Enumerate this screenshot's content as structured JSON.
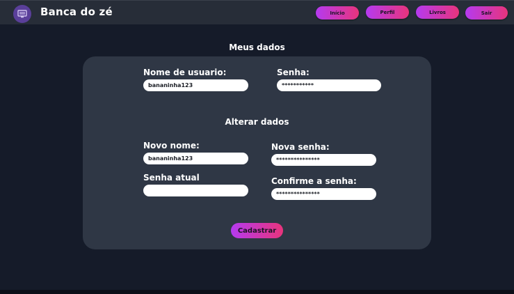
{
  "header": {
    "title": "Banca do zé",
    "logo_icon": "monitor-icon",
    "nav": [
      {
        "label": "Início"
      },
      {
        "label": "Perfil"
      },
      {
        "label": "Livros"
      },
      {
        "label": "Sair"
      }
    ]
  },
  "page": {
    "title": "Meus dados"
  },
  "my_data": {
    "username_label": "Nome de usuario:",
    "username_value": "bananinha123",
    "password_label": "Senha:",
    "password_value": "***********"
  },
  "change_data": {
    "title": "Alterar dados",
    "new_name_label": "Novo nome:",
    "new_name_value": "bananinha123",
    "current_password_label": "Senha atual",
    "current_password_value": "",
    "new_password_label": "Nova senha:",
    "new_password_value": "***************",
    "confirm_password_label": "Confirme a senha:",
    "confirm_password_value": "***************"
  },
  "submit": {
    "label": "Cadastrar"
  },
  "colors": {
    "background": "#151b29",
    "header": "#272d38",
    "card": "#2f3745",
    "accent_start": "#b53af0",
    "accent_end": "#e8347c"
  }
}
